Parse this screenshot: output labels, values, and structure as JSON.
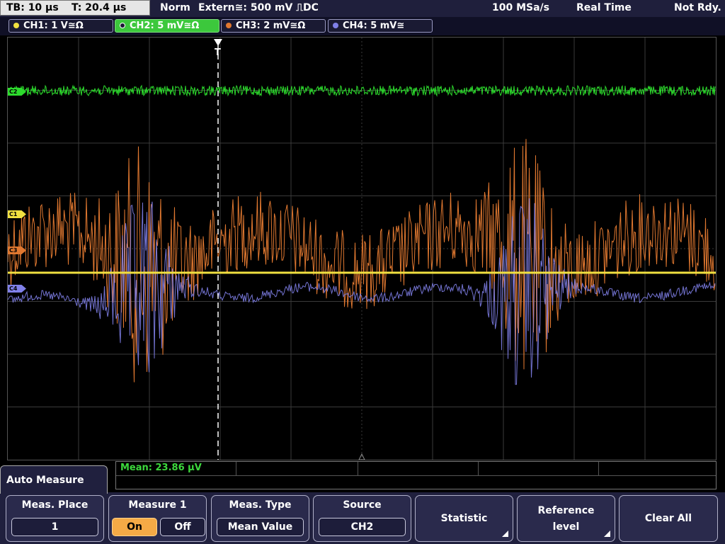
{
  "status": {
    "timebase": "TB: 10 µs",
    "trigger_time": "T: 20.4 µs",
    "trigger_mode": "Norm",
    "trigger_source": "Extern≅: 500 mV ⎍DC",
    "sample_rate": "100 MSa/s",
    "acq_mode": "Real Time",
    "acq_state": "Not Rdy."
  },
  "channels": [
    {
      "label": "CH1: 1 V≅Ω",
      "color": "#f0e040"
    },
    {
      "label": "CH2: 5 mV≅Ω",
      "color": "#2ddc2d"
    },
    {
      "label": "CH3: 2 mV≅Ω",
      "color": "#e07830"
    },
    {
      "label": "CH4: 5 mV≅",
      "color": "#8080e8"
    }
  ],
  "markers": {
    "c2": "C2",
    "c1": "C1",
    "c3": "C3",
    "c4": "C4"
  },
  "measurement": {
    "label": "Mean: 23.86 µV"
  },
  "menu": {
    "title": "Auto Measure",
    "meas_place": {
      "label": "Meas. Place",
      "value": "1"
    },
    "measure1": {
      "label": "Measure 1",
      "on": "On",
      "off": "Off"
    },
    "meas_type": {
      "label": "Meas. Type",
      "value": "Mean Value"
    },
    "source": {
      "label": "Source",
      "value": "CH2"
    },
    "statistic": {
      "label": "Statistic"
    },
    "reference": {
      "label1": "Reference",
      "label2": "level"
    },
    "clear_all": {
      "label": "Clear All"
    }
  }
}
